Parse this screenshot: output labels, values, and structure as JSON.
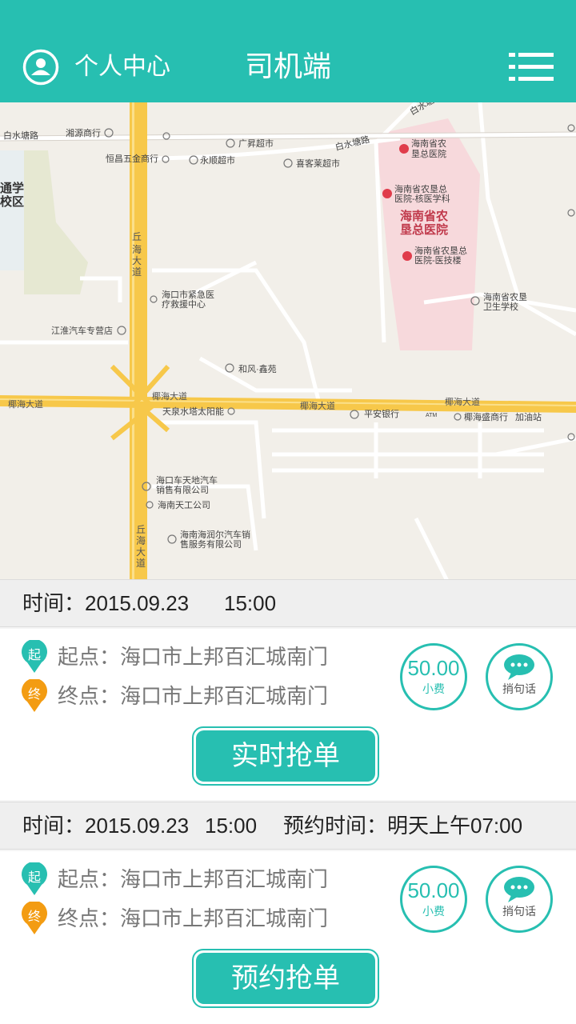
{
  "header": {
    "user_label": "个人中心",
    "title": "司机端",
    "accent_color": "#27bfb1",
    "icons": {
      "user": "user-circle-icon",
      "menu": "list-menu-icon"
    }
  },
  "map": {
    "labels": {
      "baishuitang_road_1": "白水塘路",
      "baishuitang_road_2": "白水塘路",
      "baishuitang_road_3": "白水塘",
      "xiangyuan": "湘源商行",
      "guangsheng": "广昇超市",
      "hengchang": "恒昌五金商行",
      "yongshun": "永顺超市",
      "xike": "喜客莱超市",
      "school_1": "通学",
      "school_2": "校区",
      "hospital_big_1": "海南省农",
      "hospital_big_2": "垦总医院",
      "hospital_a1": "海南省农",
      "hospital_a2": "垦总医院",
      "hospital_b1": "海南省农垦总",
      "hospital_b2": "医院-核医学科",
      "hospital_c1": "海南省农垦总",
      "hospital_c2": "医院-医技楼",
      "school_health_1": "海南省农垦",
      "school_health_2": "卫生学校",
      "qiuhai_1": "丘",
      "qiuhai_2": "海",
      "qiuhai_3": "大",
      "qiuhai_4": "道",
      "emergency_1": "海口市紧急医",
      "emergency_2": "疗救援中心",
      "jianghuai": "江淮汽车专营店",
      "hefeng": "和风·鑫苑",
      "yehai_1": "椰海大道",
      "yehai_2": "椰海大道",
      "yehai_3": "椰海大道",
      "yehai_4": "椰海大道",
      "tianquan": "天泉水塔太阳能",
      "pingan": "平安银行",
      "atm": "ATM",
      "yehaisheng": "椰海盛商行",
      "gas": "加油站",
      "chetiandi_1": "海口车天地汽车",
      "chetiandi_2": "销售有限公司",
      "nantiangong": "海南天工公司",
      "hairun_1": "海南海润尔汽车销",
      "hairun_2": "售服务有限公司",
      "qiuhai_b1": "丘",
      "qiuhai_b2": "海",
      "qiuhai_b3": "大",
      "qiuhai_b4": "道"
    }
  },
  "orders": [
    {
      "time_label": "时间：2015.09.23",
      "time_value": "15:00",
      "start": "起点：海口市上邦百汇城南门",
      "end": "终点：海口市上邦百汇城南门",
      "start_pin": "起",
      "end_pin": "终",
      "fee": "50.00",
      "fee_label": "小费",
      "msg_label": "捎句话",
      "button": "实时抢单"
    },
    {
      "time_label": "时间：2015.09.23",
      "time_value": "15:00",
      "reserve_label": "预约时间：明天上午07:00",
      "start": "起点：海口市上邦百汇城南门",
      "end": "终点：海口市上邦百汇城南门",
      "start_pin": "起",
      "end_pin": "终",
      "fee": "50.00",
      "fee_label": "小费",
      "msg_label": "捎句话",
      "button": "预约抢单"
    }
  ],
  "colors": {
    "accent": "#27bfb1",
    "end_pin": "#f39c12",
    "road_main": "#f7c84a",
    "hospital": "#f7d9dc"
  }
}
